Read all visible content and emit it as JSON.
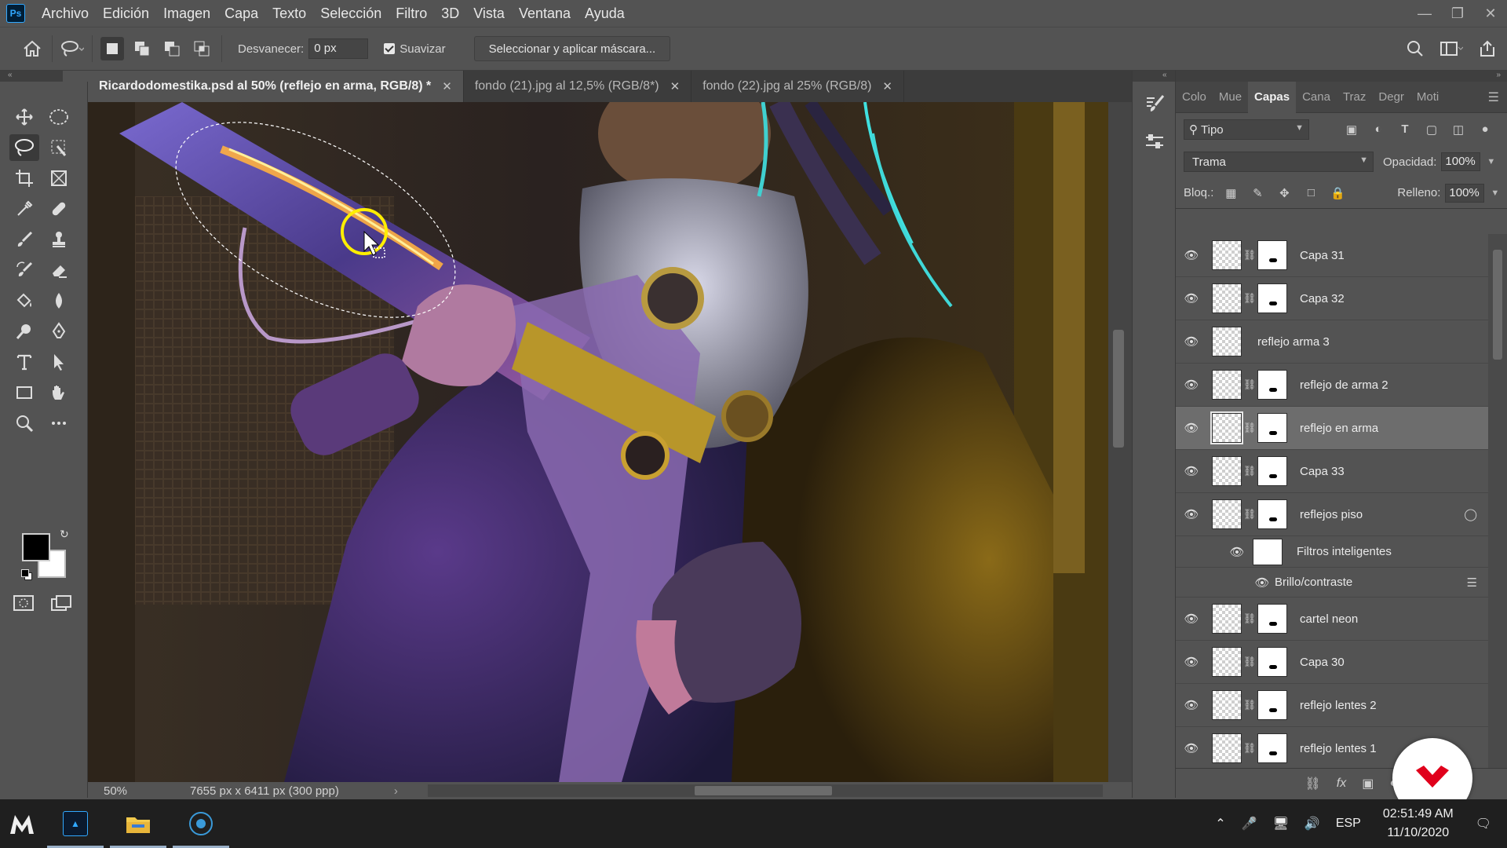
{
  "app": {
    "logo_text": "Ps"
  },
  "menu": [
    "Archivo",
    "Edición",
    "Imagen",
    "Capa",
    "Texto",
    "Selección",
    "Filtro",
    "3D",
    "Vista",
    "Ventana",
    "Ayuda"
  ],
  "options": {
    "feather_label": "Desvanecer:",
    "feather_value": "0 px",
    "antialias_label": "Suavizar",
    "antialias_checked": true,
    "mask_button": "Seleccionar y aplicar máscara..."
  },
  "tabs": [
    {
      "label": "Ricardodomestika.psd al 50% (reflejo en arma, RGB/8) *",
      "active": true
    },
    {
      "label": "fondo (21).jpg al 12,5% (RGB/8*)",
      "active": false
    },
    {
      "label": "fondo (22).jpg al 25% (RGB/8)",
      "active": false
    }
  ],
  "status": {
    "zoom": "50%",
    "dimensions": "7655 px x 6411 px (300 ppp)"
  },
  "layers_panel": {
    "tabs": [
      "Colo",
      "Mue",
      "Capas",
      "Cana",
      "Traz",
      "Degr",
      "Moti"
    ],
    "active_tab": "Capas",
    "filter": "Tipo",
    "blend_mode": "Trama",
    "opacity_label": "Opacidad:",
    "opacity": "100%",
    "lock_label": "Bloq.:",
    "fill_label": "Relleno:",
    "fill": "100%",
    "layers": [
      {
        "name": "Capa 31",
        "mask": true
      },
      {
        "name": "Capa 32",
        "mask": true
      },
      {
        "name": "reflejo arma 3",
        "mask": false
      },
      {
        "name": "reflejo de arma 2",
        "mask": true
      },
      {
        "name": "reflejo en arma",
        "mask": true,
        "selected": true
      },
      {
        "name": "Capa 33",
        "mask": true
      },
      {
        "name": "reflejos piso",
        "mask": true,
        "smart": true
      }
    ],
    "smart_filters_label": "Filtros inteligentes",
    "smart_filter_item": "Brillo/contraste",
    "layers_after": [
      {
        "name": "cartel neon",
        "mask": true
      },
      {
        "name": "Capa 30",
        "mask": true
      },
      {
        "name": "reflejo lentes 2",
        "mask": true
      },
      {
        "name": "reflejo lentes 1",
        "mask": true
      }
    ]
  },
  "taskbar": {
    "language": "ESP",
    "time": "02:51:49 AM",
    "date": "11/10/2020"
  },
  "colors": {
    "fg": "#000000",
    "bg": "#ffffff",
    "brand_red": "#e0001b"
  }
}
